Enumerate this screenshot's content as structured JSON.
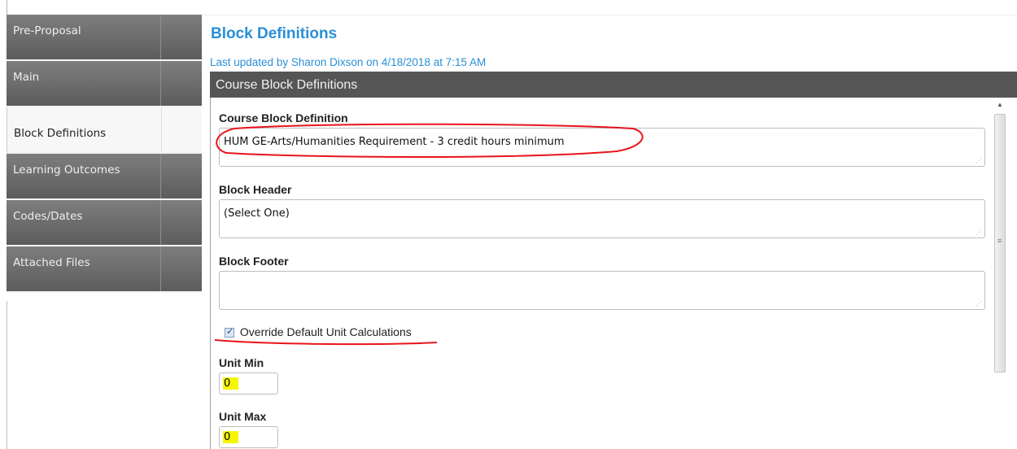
{
  "sidebar": {
    "items": [
      {
        "label": "Pre-Proposal"
      },
      {
        "label": "Main"
      },
      {
        "label": "Block Definitions"
      },
      {
        "label": "Learning Outcomes"
      },
      {
        "label": "Codes/Dates"
      },
      {
        "label": "Attached Files"
      }
    ],
    "active_index": 2
  },
  "page": {
    "title": "Block Definitions",
    "last_updated": "Last updated by Sharon Dixson on 4/18/2018 at 7:15 AM"
  },
  "panel": {
    "header": "Course Block Definitions",
    "course_block_definition": {
      "label": "Course Block Definition",
      "value": "HUM GE-Arts/Humanities Requirement - 3 credit hours minimum"
    },
    "block_header": {
      "label": "Block Header",
      "value": "(Select One)"
    },
    "block_footer": {
      "label": "Block Footer",
      "value": ""
    },
    "override": {
      "label": "Override Default Unit Calculations",
      "checked": true
    },
    "unit_min": {
      "label": "Unit Min",
      "value": "0"
    },
    "unit_max": {
      "label": "Unit Max",
      "value": "0"
    }
  },
  "colors": {
    "accent": "#2a8fd6",
    "header_bg": "#555555",
    "annotation": "#e8141c",
    "highlight": "#f6f600"
  }
}
